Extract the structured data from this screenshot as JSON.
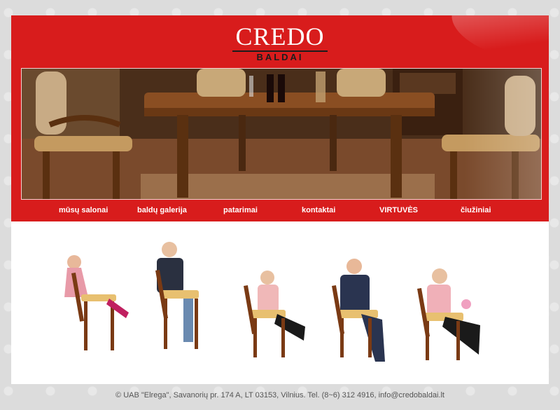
{
  "logo": {
    "name": "CREDO",
    "subtitle": "BALDAI"
  },
  "banner": {
    "image_name": "dining-room-furniture-photo"
  },
  "nav": {
    "items": [
      {
        "label": "mūsų salonai"
      },
      {
        "label": "baldų galerija"
      },
      {
        "label": "patarimai"
      },
      {
        "label": "kontaktai"
      },
      {
        "label": "VIRTUVĖS"
      },
      {
        "label": "čiužiniai"
      }
    ]
  },
  "content": {
    "image_name": "people-on-chairs-photo"
  },
  "footer": {
    "text": "© UAB \"Elrega\", Savanorių pr. 174 A, LT 03153, Vilnius. Tel. (8~6) 312 4916,",
    "email": "info@credobaldai.lt"
  },
  "colors": {
    "accent": "#d81c1c",
    "background": "#dcdcdc"
  }
}
